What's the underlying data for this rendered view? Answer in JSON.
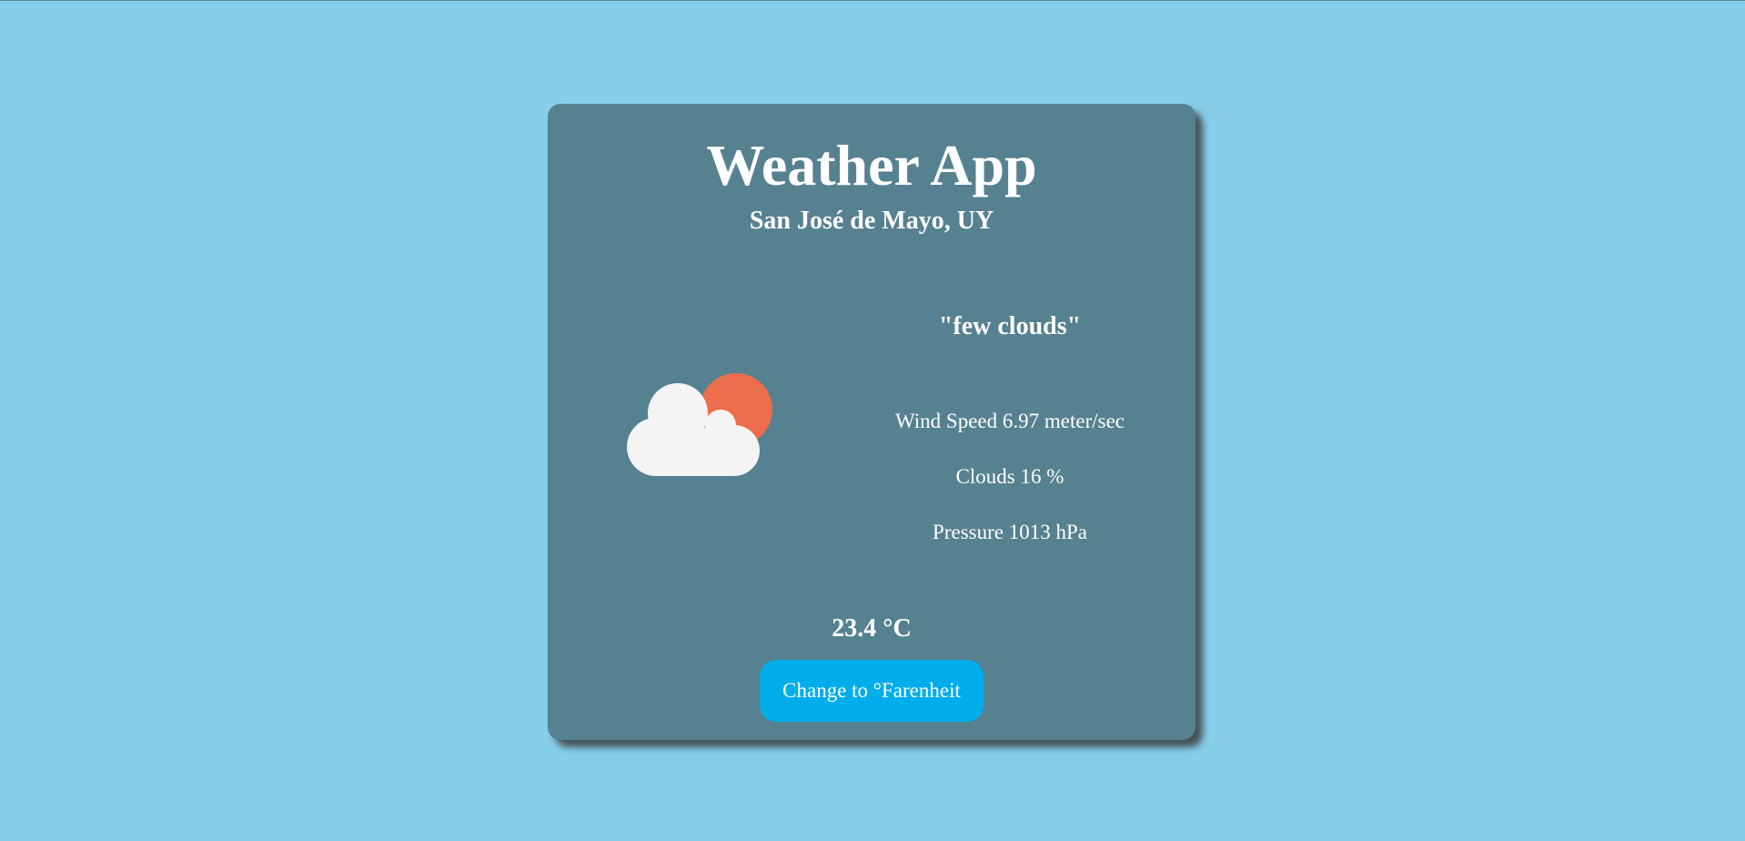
{
  "app": {
    "title": "Weather App",
    "location": "San José de Mayo, UY"
  },
  "weather": {
    "description": "\"few clouds\"",
    "icon": "few-clouds-day-icon",
    "wind_speed": "Wind Speed 6.97 meter/sec",
    "clouds": "Clouds 16 %",
    "pressure": "Pressure 1013 hPa",
    "temperature": "23.4 °C"
  },
  "actions": {
    "change_unit_label": "Change to °Farenheit"
  },
  "colors": {
    "background": "#87ceeb",
    "card": "#568190",
    "button": "#00adeb",
    "sun": "#ec6e4c",
    "cloud": "#f4f4f4"
  }
}
